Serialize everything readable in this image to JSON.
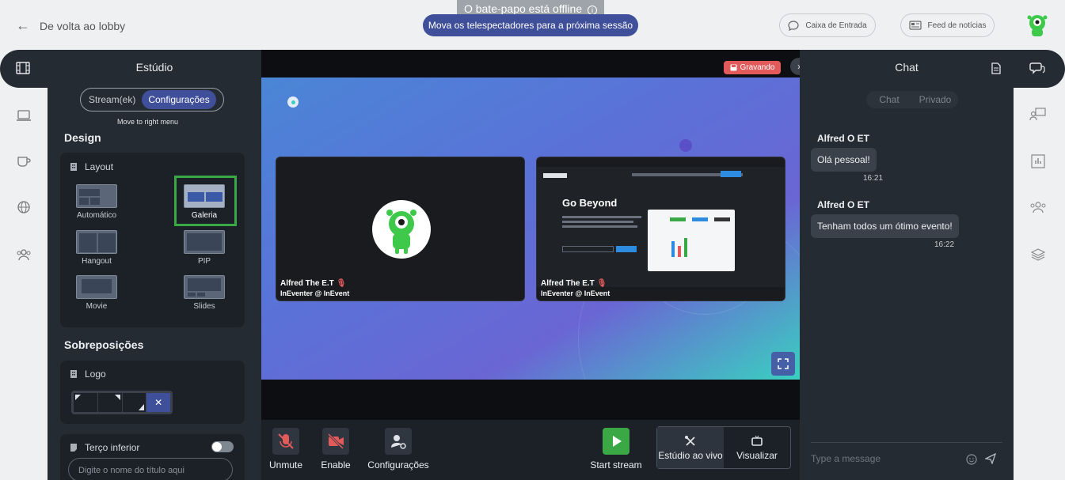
{
  "topbar": {
    "back_label": "De volta ao lobby",
    "offline_label": "O bate-papo está offline",
    "move_viewers_label": "Mova os telespectadores para a próxima sessão",
    "inbox_label": "Caixa de Entrada",
    "news_label": "Feed de notícias"
  },
  "studio": {
    "title": "Estúdio",
    "tabs": [
      "Stream(ek)",
      "Configurações"
    ],
    "move_right": "Move to right menu",
    "design_title": "Design",
    "layout_title": "Layout",
    "layouts": [
      "Automático",
      "Galeria",
      "Hangout",
      "PIP",
      "Movie",
      "Slides"
    ],
    "overlays_title": "Sobreposições",
    "logo_title": "Logo",
    "lower_third_title": "Terço inferior",
    "lower_third_placeholder": "Digite o nome do título aqui"
  },
  "stage": {
    "recording_label": "Gravando",
    "tiles": [
      {
        "name": "Alfred The E.T",
        "sub": "InEventer @ InEvent"
      },
      {
        "name": "Alfred The E.T",
        "sub": "InEventer @ InEvent"
      }
    ],
    "screen_heading": "Go Beyond",
    "controls": {
      "unmute": "Unmute",
      "enable": "Enable",
      "settings": "Configurações",
      "start_stream": "Start stream",
      "live_studio": "Estúdio ao vivo",
      "preview": "Visualizar"
    }
  },
  "chat": {
    "title": "Chat",
    "tabs": [
      "Chat",
      "Privado"
    ],
    "messages": [
      {
        "author": "Alfred O ET",
        "text": "Olá pessoal!",
        "time": "16:21"
      },
      {
        "author": "Alfred O ET",
        "text": "Tenham todos um ótimo evento!",
        "time": "16:22"
      }
    ],
    "input_placeholder": "Type a message"
  },
  "colors": {
    "accent": "#3f4f99",
    "panel": "#252b33",
    "record": "#e35a5a",
    "start": "#3aa845",
    "highlight": "#3aa845"
  }
}
